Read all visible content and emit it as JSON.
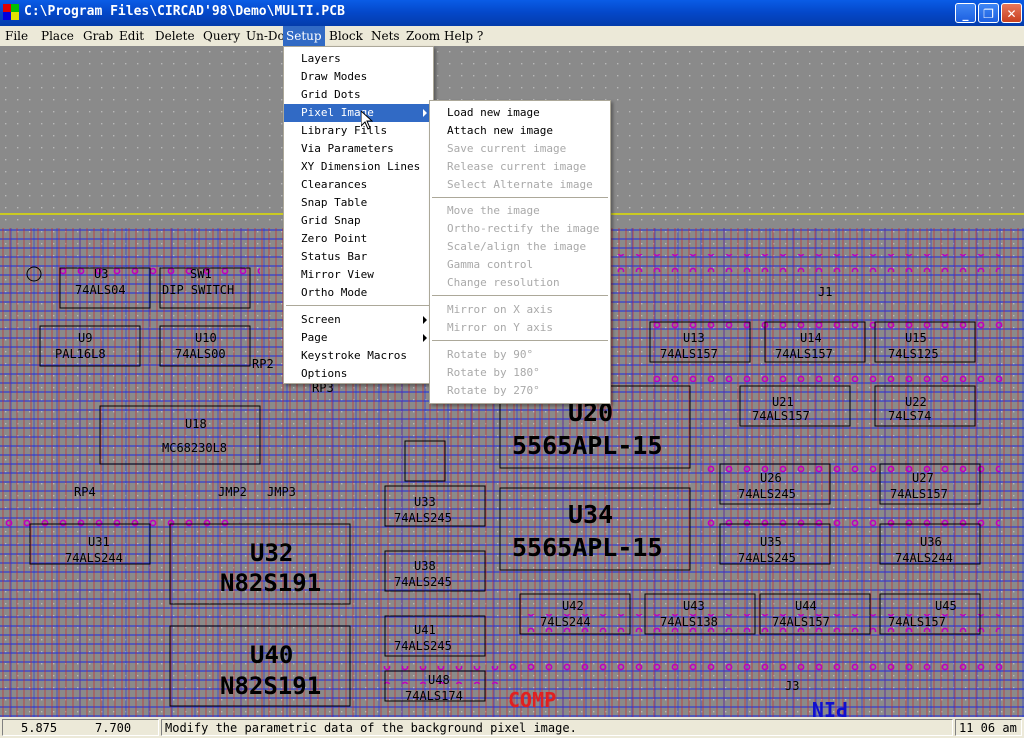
{
  "window": {
    "title": "C:\\Program Files\\CIRCAD'98\\Demo\\MULTI.PCB",
    "minimize_glyph": "_",
    "maximize_glyph": "❐",
    "close_glyph": "✕"
  },
  "menubar": {
    "items": [
      "File",
      "Place",
      "Grab",
      "Edit",
      "Delete",
      "Query",
      "Un-Do",
      "Setup",
      "Block",
      "Nets",
      "Zoom",
      "Help ?"
    ],
    "active": "Setup"
  },
  "setup_menu": {
    "group1": [
      "Layers",
      "Draw Modes",
      "Grid Dots",
      "Pixel Image",
      "Library Fills",
      "Via Parameters",
      "XY Dimension Lines",
      "Clearances",
      "Snap Table",
      "Grid Snap",
      "Zero Point",
      "Status Bar",
      "Mirror View",
      "Ortho Mode"
    ],
    "group2": [
      "Screen",
      "Page",
      "Keystroke Macros",
      "Options"
    ],
    "highlighted": "Pixel Image"
  },
  "pixel_image_submenu": {
    "group1": [
      "Load new image",
      "Attach new image",
      "Save current image",
      "Release current image",
      "Select Alternate image"
    ],
    "group2": [
      "Move the image",
      "Ortho-rectify the image",
      "Scale/align the image",
      "Gamma control",
      "Change resolution"
    ],
    "group3": [
      "Mirror on X axis",
      "Mirror on Y axis"
    ],
    "group4": [
      "Rotate by 90°",
      "Rotate by 180°",
      "Rotate by 270°"
    ]
  },
  "board": {
    "components": [
      {
        "ref": "U3",
        "part": "74ALS04"
      },
      {
        "ref": "SW1",
        "part": "DIP SWITCH"
      },
      {
        "ref": "U9",
        "part": "PAL16L8"
      },
      {
        "ref": "U10",
        "part": "74ALS00"
      },
      {
        "ref": "U18",
        "part": "MC68230L8"
      },
      {
        "ref": "U31",
        "part": "74ALS244"
      },
      {
        "ref": "U32",
        "part": "N82S191"
      },
      {
        "ref": "U40",
        "part": "N82S191"
      },
      {
        "ref": "U20",
        "part": "5565APL-15"
      },
      {
        "ref": "U34",
        "part": "5565APL-15"
      },
      {
        "ref": "U13",
        "part": "74ALS157"
      },
      {
        "ref": "U14",
        "part": "74ALS157"
      },
      {
        "ref": "U15",
        "part": "74LS125"
      },
      {
        "ref": "U21",
        "part": "74ALS157"
      },
      {
        "ref": "U22",
        "part": "74LS74"
      },
      {
        "ref": "U26",
        "part": "74ALS245"
      },
      {
        "ref": "U27",
        "part": "74ALS157"
      },
      {
        "ref": "U35",
        "part": "74ALS245"
      },
      {
        "ref": "U36",
        "part": "74ALS244"
      },
      {
        "ref": "U42",
        "part": "74LS244"
      },
      {
        "ref": "U43",
        "part": "74ALS138"
      },
      {
        "ref": "U44",
        "part": "74ALS157"
      },
      {
        "ref": "U45",
        "part": "74ALS157"
      },
      {
        "ref": "U33",
        "part": "74ALS245"
      },
      {
        "ref": "U38",
        "part": "74ALS245"
      },
      {
        "ref": "U41",
        "part": "74ALS245"
      },
      {
        "ref": "U48",
        "part": "74ALS174"
      }
    ],
    "misc_labels": [
      "RP2",
      "RP3",
      "RP4",
      "JMP2",
      "JMP3",
      "J1",
      "J3",
      "COMP",
      "PIN"
    ],
    "colors": {
      "trace_blue": "#2030e0",
      "trace_red": "#d02020",
      "pad": "#c000c0",
      "background": "#8a8a8a",
      "board_edge": "#e0e000",
      "silk": "#000000",
      "comp_text": "#e02020",
      "pin_text": "#1010d0"
    }
  },
  "statusbar": {
    "x": "5.875",
    "y": "7.700",
    "message": "Modify the parametric data of the background pixel image.",
    "time": "11 06 am"
  }
}
